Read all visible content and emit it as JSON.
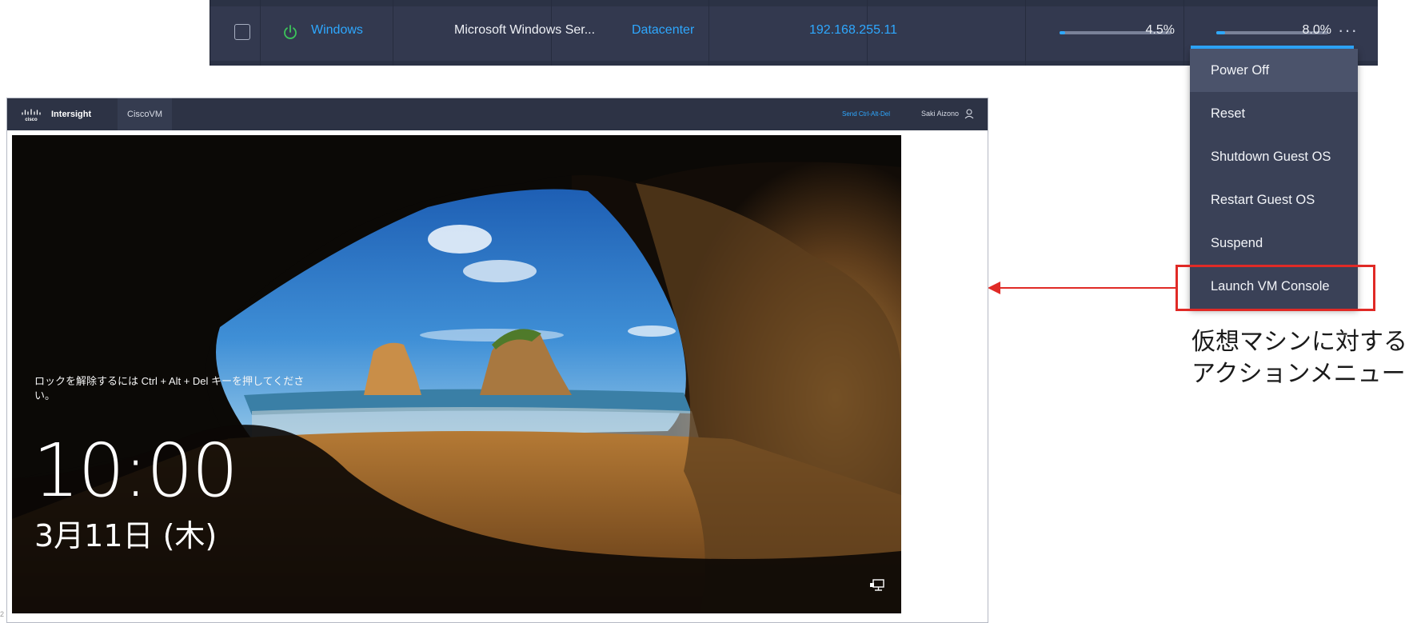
{
  "vm_row": {
    "name": "Windows",
    "os": "Microsoft Windows Ser...",
    "cluster": "Datacenter",
    "ip": "192.168.255.11",
    "cpu_usage": {
      "label": "4.5%",
      "fraction": 0.045
    },
    "memory_usage": {
      "label": "8.0%",
      "fraction": 0.08
    },
    "more_label": "···",
    "power_state": "on",
    "power_icon": "power-icon",
    "accent_color": "#2ea8ff"
  },
  "action_menu": {
    "items": [
      "Power Off",
      "Reset",
      "Shutdown Guest OS",
      "Restart Guest OS",
      "Suspend",
      "Launch VM Console"
    ],
    "highlighted": "Launch VM Console",
    "highlight_color": "#e02a26"
  },
  "annotation": {
    "line1": "仮想マシンに対する",
    "line2": "アクションメニュー"
  },
  "console": {
    "brand": "Intersight",
    "logo": "cisco-logo",
    "vm_name": "CiscoVM",
    "send_ctrl_alt_del": "Send Ctrl-Alt-Del",
    "user": "Saki Aizono",
    "lock_screen": {
      "unlock_text": "ロックを解除するには Ctrl + Alt + Del キーを押してください。",
      "time": "10:00",
      "date": "3月11日 (木)",
      "network_icon": "network-icon"
    }
  },
  "page_number": "2"
}
